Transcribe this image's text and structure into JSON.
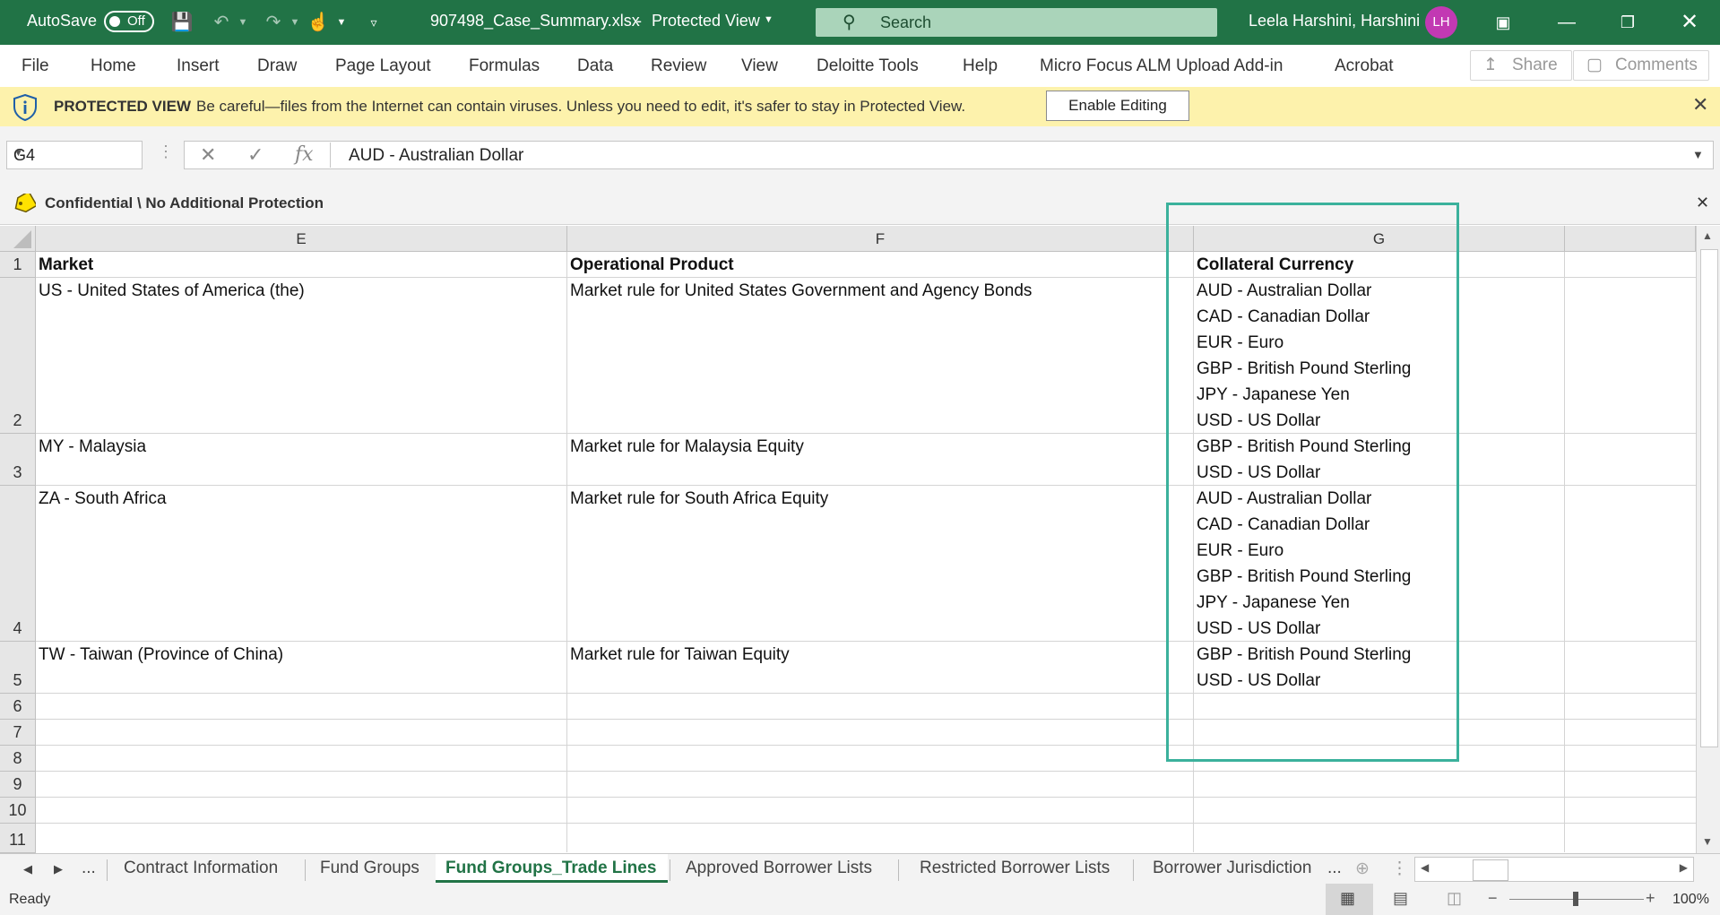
{
  "titlebar": {
    "autosave_label": "AutoSave",
    "autosave_state": "Off",
    "filename": "907498_Case_Summary.xlsx",
    "separator": "-",
    "view_mode": "Protected View",
    "search_placeholder": "Search",
    "user_name": "Leela Harshini, Harshini",
    "user_initials": "LH",
    "accent_color": "#217346"
  },
  "ribbon": {
    "tabs": [
      "File",
      "Home",
      "Insert",
      "Draw",
      "Page Layout",
      "Formulas",
      "Data",
      "Review",
      "View",
      "Deloitte Tools",
      "Help",
      "Micro Focus ALM Upload Add-in",
      "Acrobat"
    ],
    "share_label": "Share",
    "comments_label": "Comments"
  },
  "protected_view": {
    "title": "PROTECTED VIEW",
    "message": "Be careful—files from the Internet can contain viruses. Unless you need to edit, it's safer to stay in Protected View.",
    "enable_label": "Enable Editing"
  },
  "formula_bar": {
    "name_box": "G4",
    "formula_value": "AUD - Australian Dollar"
  },
  "sensitivity": {
    "label": "Confidential \\ No Additional Protection"
  },
  "sheet": {
    "columns": [
      "E",
      "F",
      "G"
    ],
    "row_numbers": [
      "1",
      "2",
      "3",
      "4",
      "5",
      "6",
      "7",
      "8",
      "9",
      "10",
      "11"
    ],
    "header": {
      "market": "Market",
      "product": "Operational Product",
      "currency": "Collateral Currency"
    },
    "rows": [
      {
        "market": "US - United States of America (the)",
        "product": "Market rule for United States Government and Agency Bonds",
        "currencies": [
          "AUD - Australian Dollar",
          "CAD - Canadian Dollar",
          "EUR - Euro",
          "GBP - British Pound Sterling",
          "JPY - Japanese Yen",
          "USD - US Dollar"
        ]
      },
      {
        "market": "MY - Malaysia",
        "product": "Market rule for Malaysia Equity",
        "currencies": [
          "GBP - British Pound Sterling",
          "USD - US Dollar"
        ]
      },
      {
        "market": "ZA - South Africa",
        "product": "Market rule for South Africa Equity",
        "currencies": [
          "AUD - Australian Dollar",
          "CAD - Canadian Dollar",
          "EUR - Euro",
          "GBP - British Pound Sterling",
          "JPY - Japanese Yen",
          "USD - US Dollar"
        ]
      },
      {
        "market": "TW - Taiwan (Province of China)",
        "product": "Market rule for Taiwan Equity",
        "currencies": [
          "GBP - British Pound Sterling",
          "USD - US Dollar"
        ]
      }
    ]
  },
  "sheet_tabs": {
    "ellipsis": "...",
    "tabs": [
      "Contract Information",
      "Fund Groups",
      "Fund Groups_Trade Lines",
      "Approved Borrower Lists",
      "Restricted Borrower Lists",
      "Borrower Jurisdiction"
    ],
    "trailing": "...",
    "active": "Fund Groups_Trade Lines"
  },
  "status": {
    "ready": "Ready",
    "zoom": "100%"
  }
}
